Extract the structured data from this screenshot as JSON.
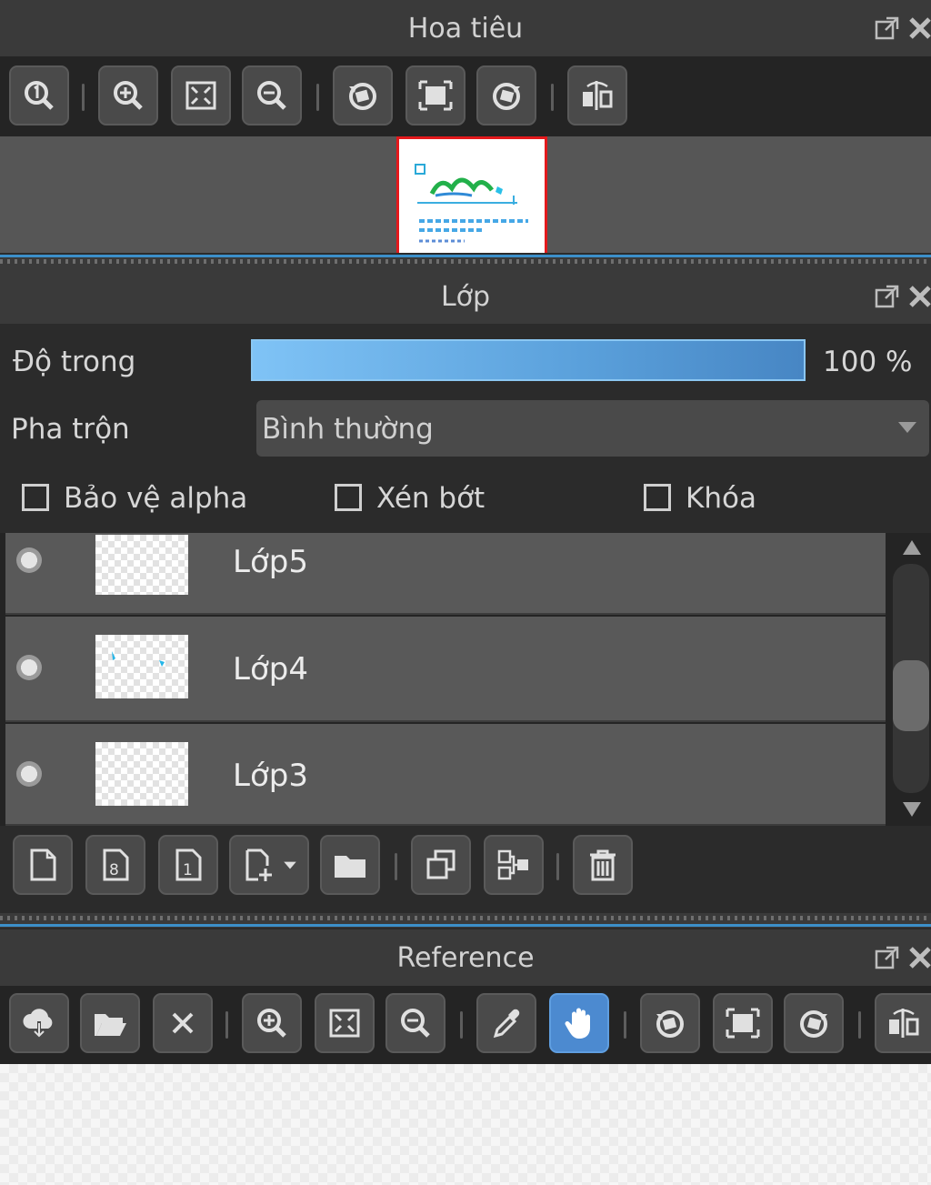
{
  "navigator": {
    "title": "Hoa tiêu",
    "toolbar": [
      "zoom-actual-icon",
      "zoom-in-icon",
      "fit-window-icon",
      "zoom-out-icon",
      "rotate-left-icon",
      "reset-view-icon",
      "rotate-right-icon",
      "flip-horizontal-icon"
    ]
  },
  "layers_panel": {
    "title": "Lớp",
    "opacity_label": "Độ trong",
    "opacity_value": "100 %",
    "opacity_percent": 100,
    "blend_label": "Pha trộn",
    "blend_value": "Bình thường",
    "protect_alpha": "Bảo vệ alpha",
    "clipping": "Xén bớt",
    "lock": "Khóa",
    "layers": [
      {
        "name": "Lớp5"
      },
      {
        "name": "Lớp4"
      },
      {
        "name": "Lớp3"
      }
    ]
  },
  "reference": {
    "title": "Reference"
  },
  "colors": {
    "accent": "#4c8ad0",
    "selection_red": "#e3191c",
    "panel_bg": "#3a3a3a"
  }
}
